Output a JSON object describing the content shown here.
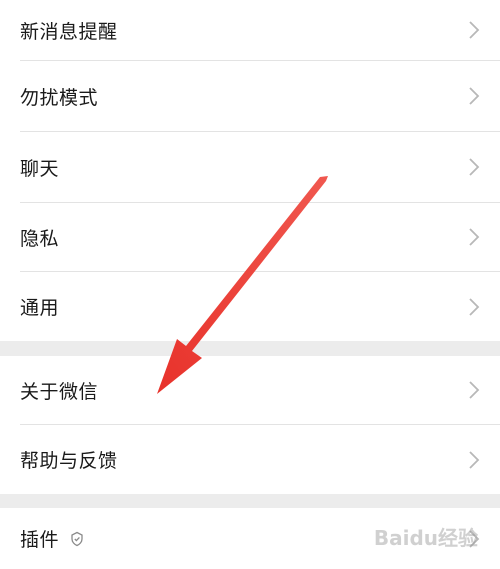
{
  "settings": {
    "items": [
      {
        "label": "新消息提醒",
        "icon": "chevron-right-icon"
      },
      {
        "label": "勿扰模式",
        "icon": "chevron-right-icon"
      },
      {
        "label": "聊天",
        "icon": "chevron-right-icon"
      },
      {
        "label": "隐私",
        "icon": "chevron-right-icon"
      },
      {
        "label": "通用",
        "icon": "chevron-right-icon"
      },
      {
        "label": "关于微信",
        "icon": "chevron-right-icon"
      },
      {
        "label": "帮助与反馈",
        "icon": "chevron-right-icon"
      },
      {
        "label": "插件",
        "icon": "chevron-right-icon",
        "badge_icon": "plugin-shield-icon"
      }
    ]
  },
  "annotation": {
    "arrow_color": "#e8322b",
    "arrow_icon": "red-arrow-icon"
  },
  "watermark": {
    "text": "Baidu经验"
  },
  "colors": {
    "background": "#ececec",
    "row_background": "#ffffff",
    "divider": "#e3e3e3",
    "text": "#1a1a1a",
    "chevron": "#b8b8b8"
  }
}
